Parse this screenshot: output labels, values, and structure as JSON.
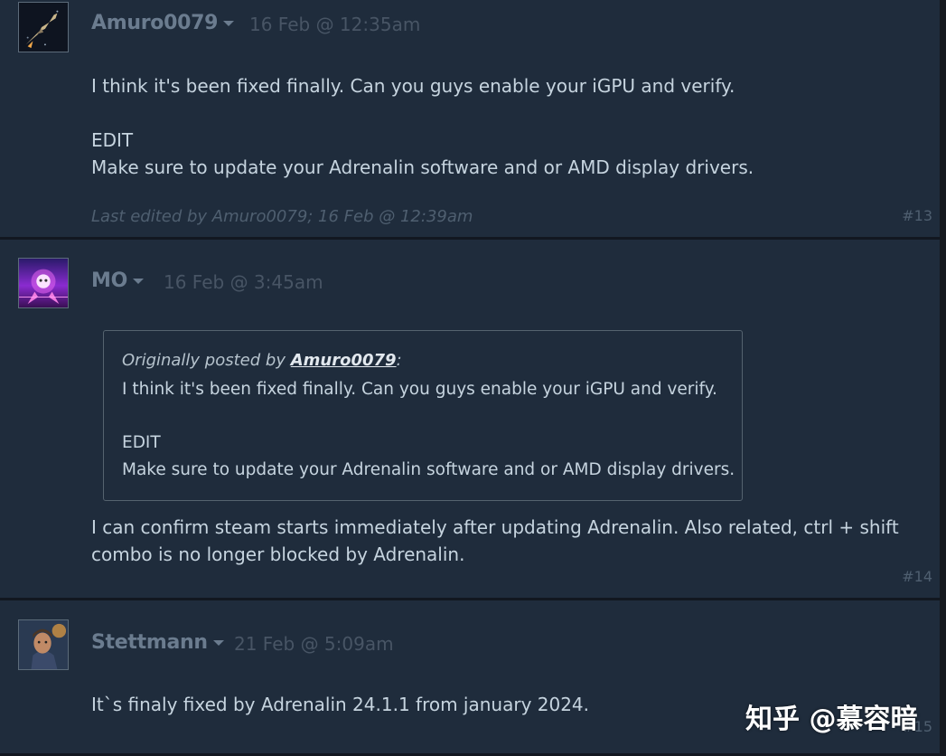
{
  "posts": [
    {
      "author": "Amuro0079",
      "date": "16 Feb @ 12:35am",
      "body": [
        "I think it's been fixed finally. Can you guys enable your iGPU and verify.",
        "",
        "EDIT",
        "Make sure to update your Adrenalin software and or AMD display drivers."
      ],
      "edited": "Last edited by Amuro0079; 16 Feb @ 12:39am",
      "number": "#13"
    },
    {
      "author": "MO",
      "date": "16 Feb @ 3:45am",
      "quote": {
        "prefix": "Originally posted by ",
        "author": "Amuro0079",
        "suffix": ":",
        "body": [
          "I think it's been fixed finally. Can you guys enable your iGPU and verify.",
          "",
          "EDIT",
          "Make sure to update your Adrenalin software and or AMD display drivers."
        ]
      },
      "body": [
        "I can confirm steam starts immediately after updating Adrenalin. Also related, ctrl + shift",
        "combo is no longer blocked by Adrenalin."
      ],
      "number": "#14"
    },
    {
      "author": "Stettmann",
      "date": "21 Feb @ 5:09am",
      "body": [
        "It`s finaly fixed by Adrenalin 24.1.1 from january 2024."
      ],
      "number": "#15"
    }
  ],
  "watermark": "知乎 @慕容暗"
}
